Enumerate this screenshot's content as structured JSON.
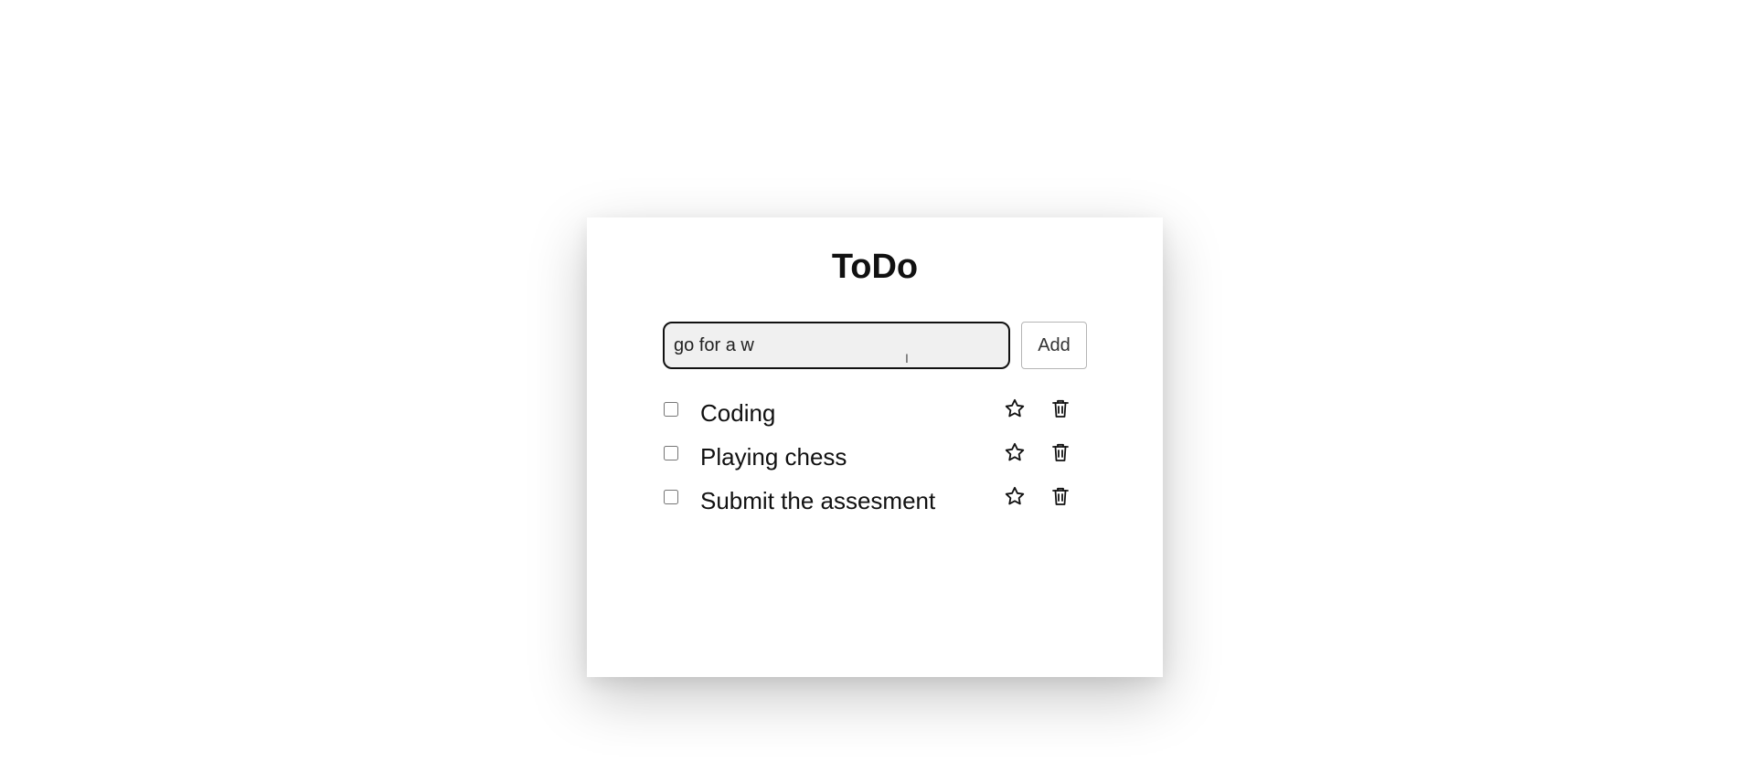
{
  "app": {
    "title": "ToDo"
  },
  "input": {
    "value": "go for a w",
    "placeholder": ""
  },
  "buttons": {
    "add_label": "Add"
  },
  "todos": [
    {
      "label": "Coding",
      "checked": false,
      "star_icon": "star-icon",
      "trash_icon": "trash-icon"
    },
    {
      "label": "Playing chess",
      "checked": false,
      "star_icon": "star-icon",
      "trash_icon": "trash-icon"
    },
    {
      "label": "Submit the assesment",
      "checked": false,
      "star_icon": "star-icon",
      "trash_icon": "trash-icon"
    }
  ],
  "colors": {
    "background": "#ffffff",
    "card": "#ffffff",
    "text": "#111111",
    "input_background": "#f0f0f0",
    "input_border": "#111111",
    "button_border": "#b5b5b5"
  }
}
